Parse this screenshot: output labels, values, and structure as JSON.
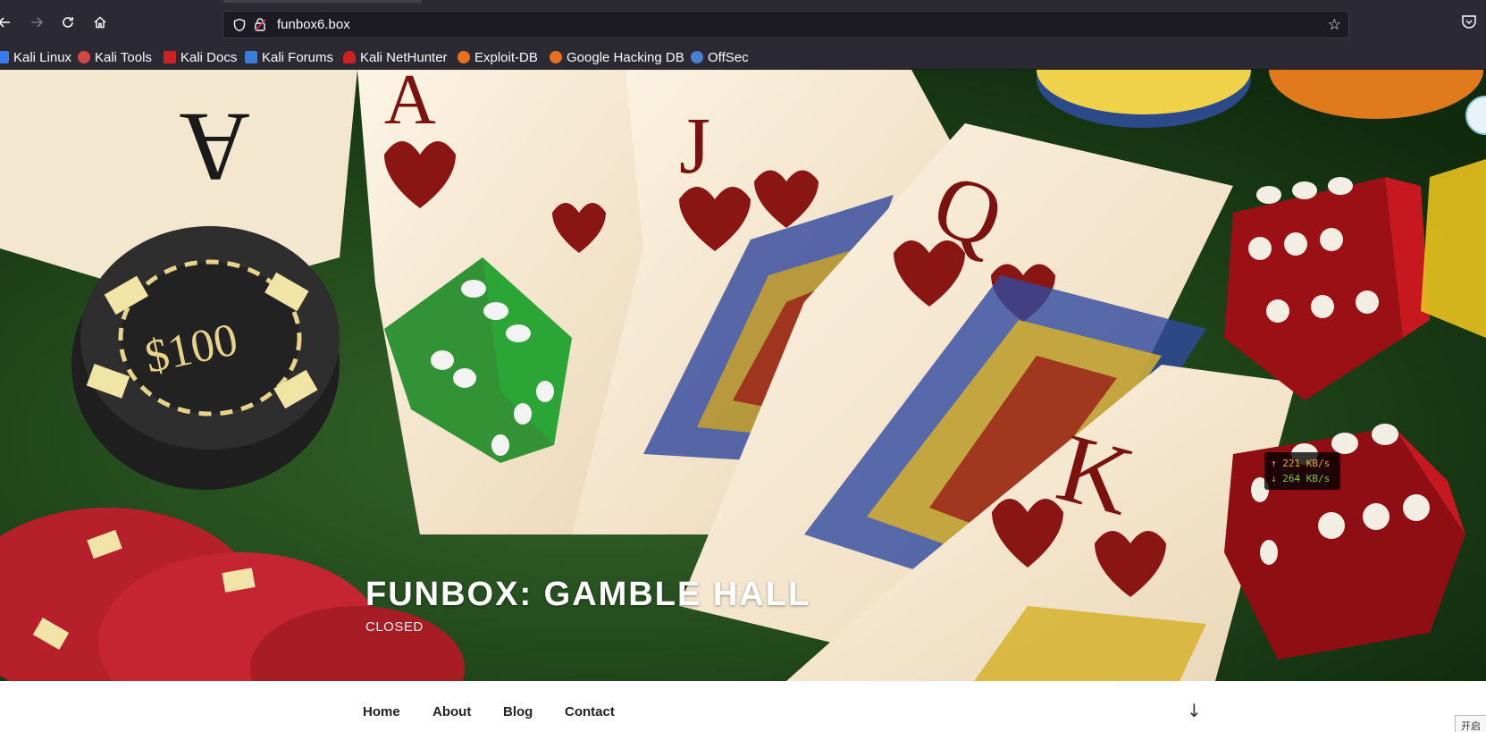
{
  "browser": {
    "url": "funbox6.box",
    "bookmarks": [
      {
        "label": "Kali Linux",
        "icon": "kali-icon",
        "color": "#367bf0"
      },
      {
        "label": "Kali Tools",
        "icon": "kali-tools-icon",
        "color": "#d64545"
      },
      {
        "label": "Kali Docs",
        "icon": "kali-docs-icon",
        "color": "#cc2222"
      },
      {
        "label": "Kali Forums",
        "icon": "kali-forums-icon",
        "color": "#3b7dd8"
      },
      {
        "label": "Kali NetHunter",
        "icon": "nethunter-icon",
        "color": "#cc2222"
      },
      {
        "label": "Exploit-DB",
        "icon": "exploit-db-icon",
        "color": "#e8701a"
      },
      {
        "label": "Google Hacking DB",
        "icon": "ghdb-icon",
        "color": "#e8701a"
      },
      {
        "label": "OffSec",
        "icon": "offsec-icon",
        "color": "#4a7fd6"
      }
    ]
  },
  "site": {
    "title": "FUNBOX: GAMBLE HALL",
    "description": "CLOSED"
  },
  "hero_image": {
    "chip_label": "$100",
    "card_letters": [
      "A",
      "A",
      "J",
      "Q",
      "K"
    ]
  },
  "speed_monitor": {
    "upload": "↑ 221 KB/s",
    "download": "↓ 264 KB/s",
    "upload_color": "#f5a623",
    "download_color": "#7ed321"
  },
  "nav": {
    "items": [
      "Home",
      "About",
      "Blog",
      "Contact"
    ]
  },
  "ime_indicator": "开启"
}
